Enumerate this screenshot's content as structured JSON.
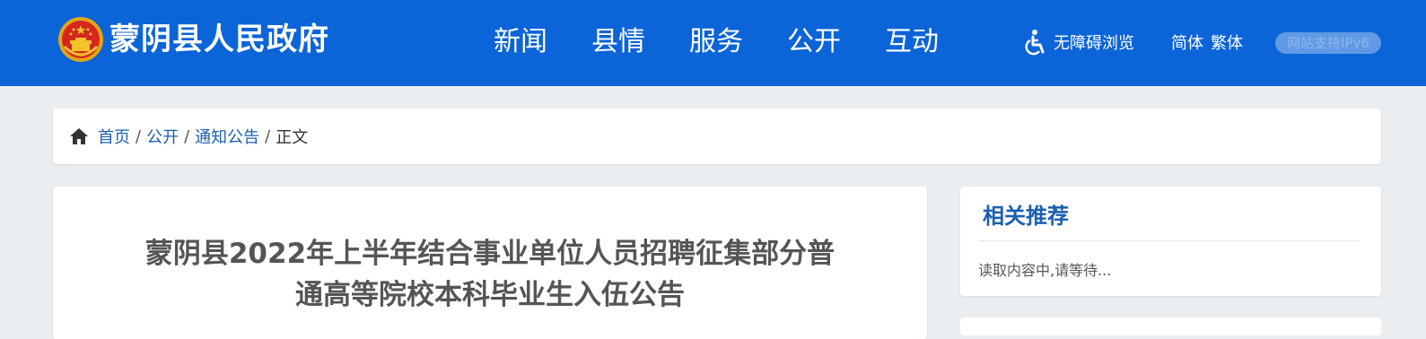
{
  "header": {
    "site_title": "蒙阴县人民政府",
    "background_color": "#0b64d8",
    "nav": [
      {
        "label": "新闻"
      },
      {
        "label": "县情"
      },
      {
        "label": "服务"
      },
      {
        "label": "公开"
      },
      {
        "label": "互动"
      }
    ],
    "accessibility_label": "无障碍浏览",
    "accessibility_icon": "wheelchair-icon",
    "lang_simplified": "简体",
    "lang_traditional": "繁体",
    "ipv6_badge": "网站支持IPv6",
    "logo_icon": "national-emblem-icon"
  },
  "breadcrumb": {
    "home_icon": "home-icon",
    "items": [
      {
        "label": "首页"
      },
      {
        "label": "公开"
      },
      {
        "label": "通知公告"
      }
    ],
    "separator": "/",
    "current": "正文"
  },
  "article": {
    "title_line1": "蒙阴县2022年上半年结合事业单位人员招聘征集部分普",
    "title_line2": "通高等院校本科毕业生入伍公告"
  },
  "sidebar": {
    "title": "相关推荐",
    "loading_text": "读取内容中,请等待..."
  },
  "colors": {
    "accent": "#1a5fb0",
    "page_background": "#ebeef1"
  }
}
